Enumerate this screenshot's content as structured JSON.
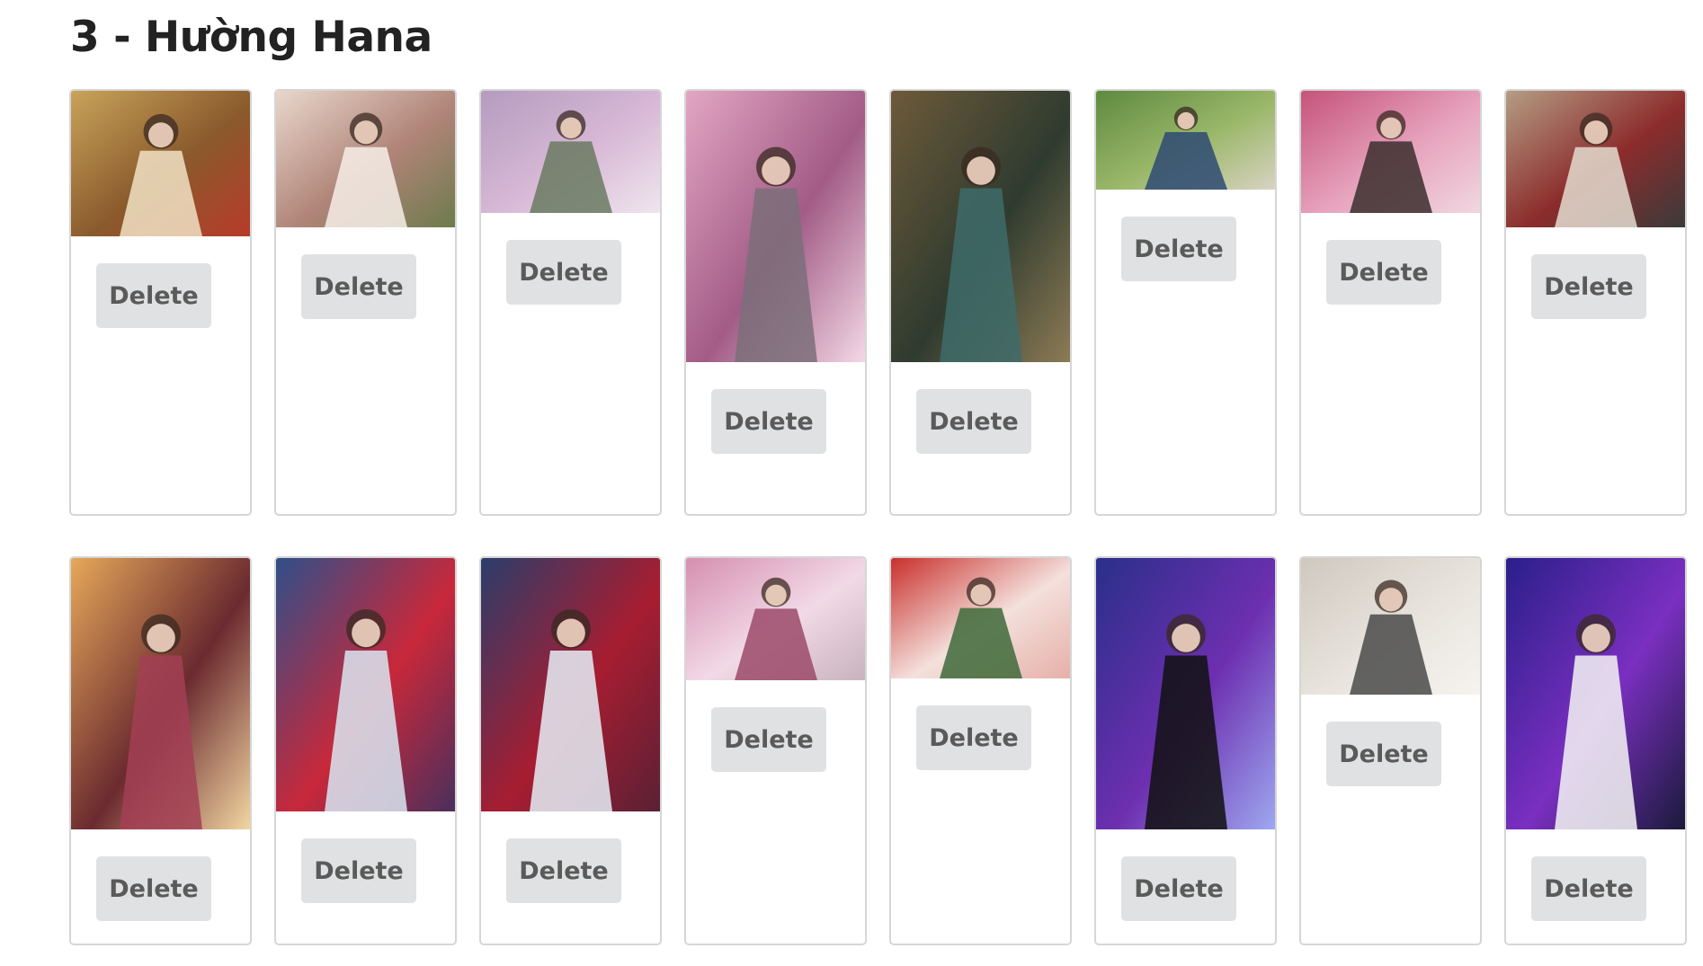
{
  "page": {
    "title": "3 - Hường Hana",
    "delete_label": "Delete"
  },
  "colors": {
    "card_border": "#d6d6d6",
    "button_bg": "#e0e1e2",
    "button_text": "#5a5a5a",
    "title_text": "#222222"
  },
  "gallery": {
    "rows": [
      {
        "photos": [
          {
            "alt": "portrait-warm-indoor"
          },
          {
            "alt": "portrait-collage"
          },
          {
            "alt": "portrait-cherry-blossom-bench"
          },
          {
            "alt": "portrait-cherry-blossom-dress"
          },
          {
            "alt": "portrait-floral-gown-steps"
          },
          {
            "alt": "portrait-park-blue-top"
          },
          {
            "alt": "portrait-blossoms-qipao"
          },
          {
            "alt": "portrait-selfie-sports-top"
          }
        ]
      },
      {
        "photos": [
          {
            "alt": "portrait-sunset-red-qipao"
          },
          {
            "alt": "portrait-red-hat-snow"
          },
          {
            "alt": "portrait-red-scarf-snow"
          },
          {
            "alt": "portrait-pink-blossoms"
          },
          {
            "alt": "portrait-red-lanterns"
          },
          {
            "alt": "portrait-stage-black-dress"
          },
          {
            "alt": "portrait-mask-white-outfit"
          },
          {
            "alt": "portrait-stage-white-gown"
          }
        ]
      }
    ]
  }
}
